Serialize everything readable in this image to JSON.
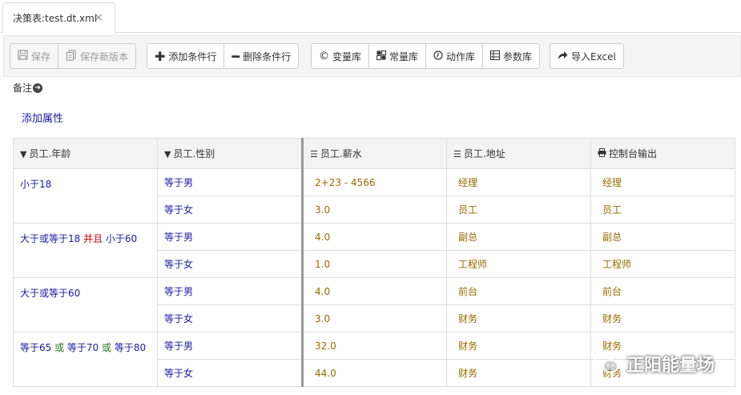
{
  "tab": {
    "title": "决策表:test.dt.xml",
    "close": "×"
  },
  "toolbar": {
    "save": "保存",
    "save_new_version": "保存新版本",
    "add_condition_row": "添加条件行",
    "delete_condition_row": "删除条件行",
    "variable_lib": "变量库",
    "constant_lib": "常量库",
    "action_lib": "动作库",
    "parameter_lib": "参数库",
    "import_excel": "导入Excel"
  },
  "remark": {
    "label": "备注"
  },
  "add_property": "添加属性",
  "table": {
    "headers": [
      "员工.年龄",
      "员工.性别",
      "员工.薪水",
      "员工.地址",
      "控制台输出"
    ],
    "groups": [
      {
        "condition": {
          "parts": [
            {
              "t": "小于18",
              "k": ""
            }
          ]
        },
        "rows": [
          {
            "sex": "等于男",
            "salary": "2+23 - 4566",
            "address": "经理",
            "output": "经理"
          },
          {
            "sex": "等于女",
            "salary": "3.0",
            "address": "员工",
            "output": "员工"
          }
        ]
      },
      {
        "condition": {
          "parts": [
            {
              "t": "大于或等于18 ",
              "k": ""
            },
            {
              "t": "并且",
              "k": "and"
            },
            {
              "t": " 小于60",
              "k": ""
            }
          ]
        },
        "rows": [
          {
            "sex": "等于男",
            "salary": "4.0",
            "address": "副总",
            "output": "副总"
          },
          {
            "sex": "等于女",
            "salary": "1.0",
            "address": "工程师",
            "output": "工程师"
          }
        ]
      },
      {
        "condition": {
          "parts": [
            {
              "t": "大于或等于60",
              "k": ""
            }
          ]
        },
        "rows": [
          {
            "sex": "等于男",
            "salary": "4.0",
            "address": "前台",
            "output": "前台"
          },
          {
            "sex": "等于女",
            "salary": "3.0",
            "address": "财务",
            "output": "财务"
          }
        ]
      },
      {
        "condition": {
          "parts": [
            {
              "t": "等于65 ",
              "k": ""
            },
            {
              "t": "或",
              "k": "or"
            },
            {
              "t": " 等于70 ",
              "k": ""
            },
            {
              "t": "或",
              "k": "or"
            },
            {
              "t": " 等于80",
              "k": ""
            }
          ]
        },
        "rows": [
          {
            "sex": "等于男",
            "salary": "32.0",
            "address": "财务",
            "output": "财务"
          },
          {
            "sex": "等于女",
            "salary": "44.0",
            "address": "财务",
            "output": "财务"
          }
        ]
      }
    ]
  },
  "watermark": {
    "text": "正阳能量场"
  },
  "colors": {
    "condition_text": "#1a1aa6",
    "action_text": "#9a6a00",
    "and_keyword": "#c00000",
    "or_keyword": "#1e7a1e"
  },
  "icons": {
    "save": "floppy-disk-icon",
    "save_new_version": "document-copy-icon",
    "add_row": "plus-icon",
    "delete_row": "minus-icon",
    "variable_lib": "copyright-circle-icon",
    "constant_lib": "grid-icon",
    "action_lib": "clock-circle-icon",
    "parameter_lib": "table-grid-icon",
    "import_excel": "share-arrow-icon",
    "remark_toggle": "arrow-circle-right-icon",
    "condition_header": "filter-icon",
    "action_header": "list-icon",
    "console_header": "printer-icon",
    "watermark": "wechat-icon"
  }
}
